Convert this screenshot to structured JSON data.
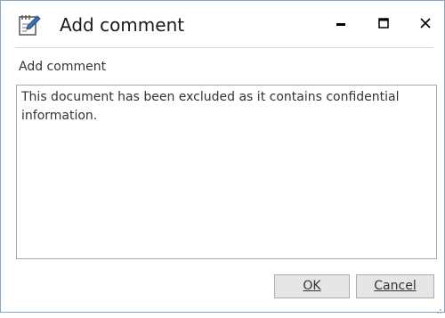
{
  "window": {
    "title": "Add comment",
    "icon": "edit-note-icon",
    "controls": [
      "minimize-icon",
      "maximize-icon",
      "close-icon"
    ]
  },
  "form": {
    "label": "Add comment",
    "comment_value": "This document has been excluded as it contains confidential information."
  },
  "buttons": {
    "ok_label": "OK",
    "cancel_label": "Cancel"
  },
  "colors": {
    "accent": "#3c6eb4",
    "window_border": "#8aa6c1"
  }
}
